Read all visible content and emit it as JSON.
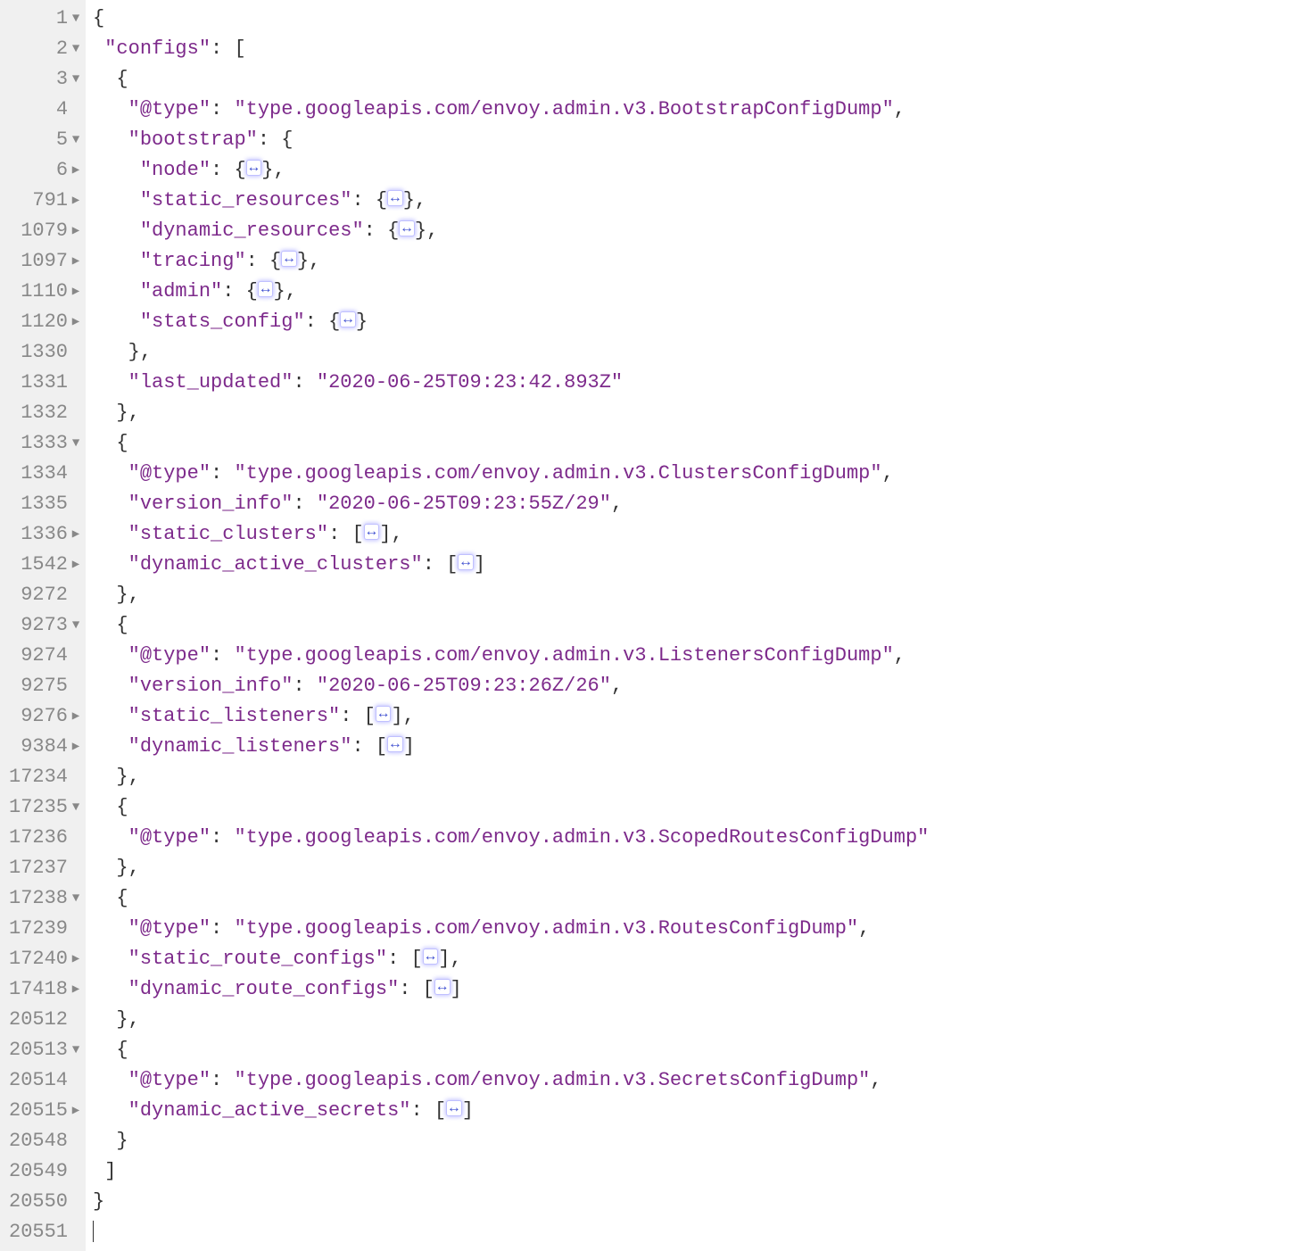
{
  "lines": [
    {
      "num": "1",
      "fold": "down",
      "indent": 0,
      "segs": [
        {
          "t": "punct",
          "v": "{"
        }
      ]
    },
    {
      "num": "2",
      "fold": "down",
      "indent": 1,
      "segs": [
        {
          "t": "key",
          "v": "\"configs\""
        },
        {
          "t": "punct",
          "v": ": ["
        }
      ]
    },
    {
      "num": "3",
      "fold": "down",
      "indent": 2,
      "segs": [
        {
          "t": "punct",
          "v": "{"
        }
      ]
    },
    {
      "num": "4",
      "fold": "none",
      "indent": 3,
      "segs": [
        {
          "t": "key",
          "v": "\"@type\""
        },
        {
          "t": "punct",
          "v": ": "
        },
        {
          "t": "string",
          "v": "\"type.googleapis.com/envoy.admin.v3.BootstrapConfigDump\""
        },
        {
          "t": "punct",
          "v": ","
        }
      ]
    },
    {
      "num": "5",
      "fold": "down",
      "indent": 3,
      "segs": [
        {
          "t": "key",
          "v": "\"bootstrap\""
        },
        {
          "t": "punct",
          "v": ": {"
        }
      ]
    },
    {
      "num": "6",
      "fold": "right",
      "indent": 4,
      "segs": [
        {
          "t": "key",
          "v": "\"node\""
        },
        {
          "t": "punct",
          "v": ": {"
        },
        {
          "t": "fold",
          "v": "↔"
        },
        {
          "t": "punct",
          "v": "},"
        }
      ]
    },
    {
      "num": "791",
      "fold": "right",
      "indent": 4,
      "segs": [
        {
          "t": "key",
          "v": "\"static_resources\""
        },
        {
          "t": "punct",
          "v": ": {"
        },
        {
          "t": "fold",
          "v": "↔"
        },
        {
          "t": "punct",
          "v": "},"
        }
      ]
    },
    {
      "num": "1079",
      "fold": "right",
      "indent": 4,
      "segs": [
        {
          "t": "key",
          "v": "\"dynamic_resources\""
        },
        {
          "t": "punct",
          "v": ": {"
        },
        {
          "t": "fold",
          "v": "↔"
        },
        {
          "t": "punct",
          "v": "},"
        }
      ]
    },
    {
      "num": "1097",
      "fold": "right",
      "indent": 4,
      "segs": [
        {
          "t": "key",
          "v": "\"tracing\""
        },
        {
          "t": "punct",
          "v": ": {"
        },
        {
          "t": "fold",
          "v": "↔"
        },
        {
          "t": "punct",
          "v": "},"
        }
      ]
    },
    {
      "num": "1110",
      "fold": "right",
      "indent": 4,
      "segs": [
        {
          "t": "key",
          "v": "\"admin\""
        },
        {
          "t": "punct",
          "v": ": {"
        },
        {
          "t": "fold",
          "v": "↔"
        },
        {
          "t": "punct",
          "v": "},"
        }
      ]
    },
    {
      "num": "1120",
      "fold": "right",
      "indent": 4,
      "segs": [
        {
          "t": "key",
          "v": "\"stats_config\""
        },
        {
          "t": "punct",
          "v": ": {"
        },
        {
          "t": "fold",
          "v": "↔"
        },
        {
          "t": "punct",
          "v": "}"
        }
      ]
    },
    {
      "num": "1330",
      "fold": "none",
      "indent": 3,
      "segs": [
        {
          "t": "punct",
          "v": "},"
        }
      ]
    },
    {
      "num": "1331",
      "fold": "none",
      "indent": 3,
      "segs": [
        {
          "t": "key",
          "v": "\"last_updated\""
        },
        {
          "t": "punct",
          "v": ": "
        },
        {
          "t": "string",
          "v": "\"2020-06-25T09:23:42.893Z\""
        }
      ]
    },
    {
      "num": "1332",
      "fold": "none",
      "indent": 2,
      "segs": [
        {
          "t": "punct",
          "v": "},"
        }
      ]
    },
    {
      "num": "1333",
      "fold": "down",
      "indent": 2,
      "segs": [
        {
          "t": "punct",
          "v": "{"
        }
      ]
    },
    {
      "num": "1334",
      "fold": "none",
      "indent": 3,
      "segs": [
        {
          "t": "key",
          "v": "\"@type\""
        },
        {
          "t": "punct",
          "v": ": "
        },
        {
          "t": "string",
          "v": "\"type.googleapis.com/envoy.admin.v3.ClustersConfigDump\""
        },
        {
          "t": "punct",
          "v": ","
        }
      ]
    },
    {
      "num": "1335",
      "fold": "none",
      "indent": 3,
      "segs": [
        {
          "t": "key",
          "v": "\"version_info\""
        },
        {
          "t": "punct",
          "v": ": "
        },
        {
          "t": "string",
          "v": "\"2020-06-25T09:23:55Z/29\""
        },
        {
          "t": "punct",
          "v": ","
        }
      ]
    },
    {
      "num": "1336",
      "fold": "right",
      "indent": 3,
      "segs": [
        {
          "t": "key",
          "v": "\"static_clusters\""
        },
        {
          "t": "punct",
          "v": ": ["
        },
        {
          "t": "fold",
          "v": "↔"
        },
        {
          "t": "punct",
          "v": "],"
        }
      ]
    },
    {
      "num": "1542",
      "fold": "right",
      "indent": 3,
      "segs": [
        {
          "t": "key",
          "v": "\"dynamic_active_clusters\""
        },
        {
          "t": "punct",
          "v": ": ["
        },
        {
          "t": "fold",
          "v": "↔"
        },
        {
          "t": "punct",
          "v": "]"
        }
      ]
    },
    {
      "num": "9272",
      "fold": "none",
      "indent": 2,
      "segs": [
        {
          "t": "punct",
          "v": "},"
        }
      ]
    },
    {
      "num": "9273",
      "fold": "down",
      "indent": 2,
      "segs": [
        {
          "t": "punct",
          "v": "{"
        }
      ]
    },
    {
      "num": "9274",
      "fold": "none",
      "indent": 3,
      "segs": [
        {
          "t": "key",
          "v": "\"@type\""
        },
        {
          "t": "punct",
          "v": ": "
        },
        {
          "t": "string",
          "v": "\"type.googleapis.com/envoy.admin.v3.ListenersConfigDump\""
        },
        {
          "t": "punct",
          "v": ","
        }
      ]
    },
    {
      "num": "9275",
      "fold": "none",
      "indent": 3,
      "segs": [
        {
          "t": "key",
          "v": "\"version_info\""
        },
        {
          "t": "punct",
          "v": ": "
        },
        {
          "t": "string",
          "v": "\"2020-06-25T09:23:26Z/26\""
        },
        {
          "t": "punct",
          "v": ","
        }
      ]
    },
    {
      "num": "9276",
      "fold": "right",
      "indent": 3,
      "segs": [
        {
          "t": "key",
          "v": "\"static_listeners\""
        },
        {
          "t": "punct",
          "v": ": ["
        },
        {
          "t": "fold",
          "v": "↔"
        },
        {
          "t": "punct",
          "v": "],"
        }
      ]
    },
    {
      "num": "9384",
      "fold": "right",
      "indent": 3,
      "segs": [
        {
          "t": "key",
          "v": "\"dynamic_listeners\""
        },
        {
          "t": "punct",
          "v": ": ["
        },
        {
          "t": "fold",
          "v": "↔"
        },
        {
          "t": "punct",
          "v": "]"
        }
      ]
    },
    {
      "num": "17234",
      "fold": "none",
      "indent": 2,
      "segs": [
        {
          "t": "punct",
          "v": "},"
        }
      ]
    },
    {
      "num": "17235",
      "fold": "down",
      "indent": 2,
      "segs": [
        {
          "t": "punct",
          "v": "{"
        }
      ]
    },
    {
      "num": "17236",
      "fold": "none",
      "indent": 3,
      "segs": [
        {
          "t": "key",
          "v": "\"@type\""
        },
        {
          "t": "punct",
          "v": ": "
        },
        {
          "t": "string",
          "v": "\"type.googleapis.com/envoy.admin.v3.ScopedRoutesConfigDump\""
        }
      ]
    },
    {
      "num": "17237",
      "fold": "none",
      "indent": 2,
      "segs": [
        {
          "t": "punct",
          "v": "},"
        }
      ]
    },
    {
      "num": "17238",
      "fold": "down",
      "indent": 2,
      "segs": [
        {
          "t": "punct",
          "v": "{"
        }
      ]
    },
    {
      "num": "17239",
      "fold": "none",
      "indent": 3,
      "segs": [
        {
          "t": "key",
          "v": "\"@type\""
        },
        {
          "t": "punct",
          "v": ": "
        },
        {
          "t": "string",
          "v": "\"type.googleapis.com/envoy.admin.v3.RoutesConfigDump\""
        },
        {
          "t": "punct",
          "v": ","
        }
      ]
    },
    {
      "num": "17240",
      "fold": "right",
      "indent": 3,
      "segs": [
        {
          "t": "key",
          "v": "\"static_route_configs\""
        },
        {
          "t": "punct",
          "v": ": ["
        },
        {
          "t": "fold",
          "v": "↔"
        },
        {
          "t": "punct",
          "v": "],"
        }
      ]
    },
    {
      "num": "17418",
      "fold": "right",
      "indent": 3,
      "segs": [
        {
          "t": "key",
          "v": "\"dynamic_route_configs\""
        },
        {
          "t": "punct",
          "v": ": ["
        },
        {
          "t": "fold",
          "v": "↔"
        },
        {
          "t": "punct",
          "v": "]"
        }
      ]
    },
    {
      "num": "20512",
      "fold": "none",
      "indent": 2,
      "segs": [
        {
          "t": "punct",
          "v": "},"
        }
      ]
    },
    {
      "num": "20513",
      "fold": "down",
      "indent": 2,
      "segs": [
        {
          "t": "punct",
          "v": "{"
        }
      ]
    },
    {
      "num": "20514",
      "fold": "none",
      "indent": 3,
      "segs": [
        {
          "t": "key",
          "v": "\"@type\""
        },
        {
          "t": "punct",
          "v": ": "
        },
        {
          "t": "string",
          "v": "\"type.googleapis.com/envoy.admin.v3.SecretsConfigDump\""
        },
        {
          "t": "punct",
          "v": ","
        }
      ]
    },
    {
      "num": "20515",
      "fold": "right",
      "indent": 3,
      "segs": [
        {
          "t": "key",
          "v": "\"dynamic_active_secrets\""
        },
        {
          "t": "punct",
          "v": ": ["
        },
        {
          "t": "fold",
          "v": "↔"
        },
        {
          "t": "punct",
          "v": "]"
        }
      ]
    },
    {
      "num": "20548",
      "fold": "none",
      "indent": 2,
      "segs": [
        {
          "t": "punct",
          "v": "}"
        }
      ]
    },
    {
      "num": "20549",
      "fold": "none",
      "indent": 1,
      "segs": [
        {
          "t": "punct",
          "v": "]"
        }
      ]
    },
    {
      "num": "20550",
      "fold": "none",
      "indent": 0,
      "segs": [
        {
          "t": "punct",
          "v": "}"
        }
      ]
    },
    {
      "num": "20551",
      "fold": "none",
      "indent": 0,
      "segs": [
        {
          "t": "cursor",
          "v": ""
        }
      ]
    }
  ],
  "fold_arrow_down": "▼",
  "fold_arrow_right": "▶",
  "fold_widget_glyph": "↔"
}
